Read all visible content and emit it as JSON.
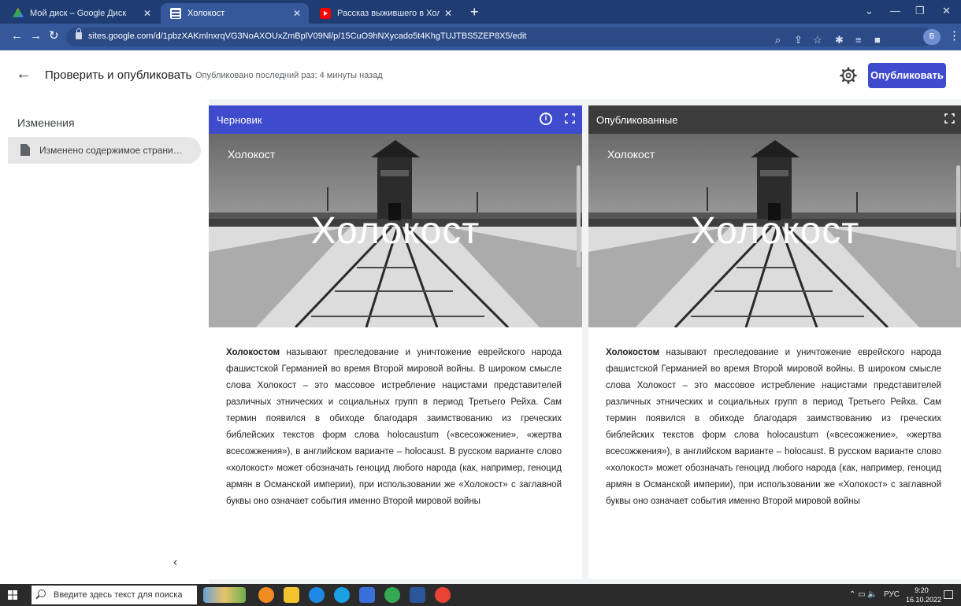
{
  "browser": {
    "tabs": [
      {
        "title": "Мой диск – Google Диск",
        "favicon": "google-drive-icon"
      },
      {
        "title": "Холокост",
        "favicon": "google-sites-icon",
        "active": true
      },
      {
        "title": "Рассказ выжившего в Холокосте",
        "favicon": "youtube-icon"
      }
    ],
    "new_tab_label": "+",
    "url": "sites.google.com/d/1pbzXAKmlnxrqVG3NoAXOUxZmBplV09Nl/p/15CuO9hNXycado5t4KhgTUJTBS5ZEP8X5/edit",
    "profile_initial": "B"
  },
  "header": {
    "title": "Проверить и опубликовать",
    "subtitle": "Опубликовано последний раз: 4 минуты назад",
    "publish_label": "Опубликовать"
  },
  "sidebar": {
    "title": "Изменения",
    "items": [
      {
        "label": "Изменено содержимое страни…"
      }
    ]
  },
  "panes": {
    "draft": {
      "label": "Черновик",
      "color": "#3e4bcc",
      "info_glyph": "i"
    },
    "published": {
      "label": "Опубликованные",
      "color": "#3c3c3c"
    },
    "site_name": "Холокост",
    "hero_title": "Холокост",
    "article_lead": "Холокостом",
    "article_text": " называют преследование и уничтожение еврейского народа фашистской Германией во время Второй мировой войны. В широком смысле слова Холокост – это массовое истребление нацистами представителей различных этнических и социальных групп в период Третьего Рейха. Сам термин появился в обиходе благодаря заимствованию из греческих библейских текстов форм слова holocaustum («всесожжение», «жертва всесожжения»), в английском варианте – holocaust. В русском варианте слово «холокост» может обозначать геноцид любого народа (как, например, геноцид армян в Османской империи), при использовании же «Холокост» с заглавной буквы оно означает события именно Второй мировой войны"
  },
  "taskbar": {
    "search_placeholder": "Введите здесь текст для поиска",
    "tray_lang": "РУС",
    "time": "9:20",
    "date": "16.10.2022"
  }
}
